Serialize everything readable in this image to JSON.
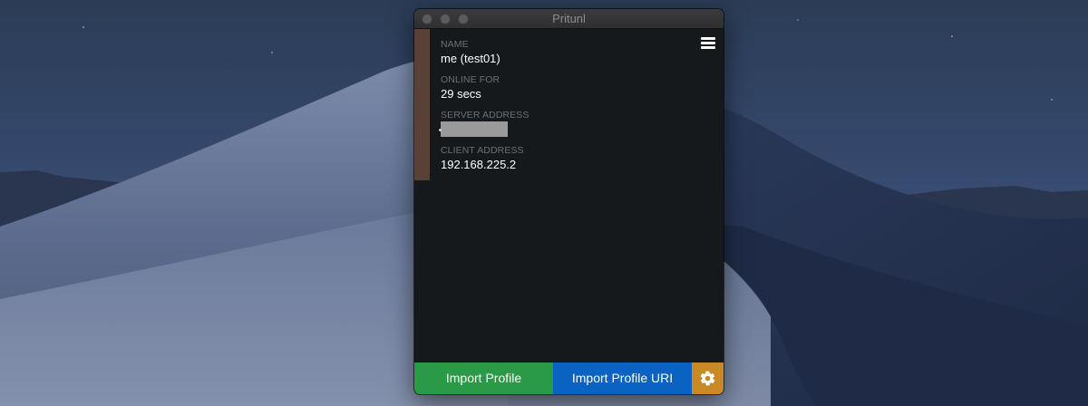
{
  "window": {
    "title": "Pritunl"
  },
  "profile": {
    "status_color": "#5a4137",
    "name_label": "NAME",
    "name_value": "me (test01)",
    "online_label": "ONLINE FOR",
    "online_value": "29 secs",
    "server_label": "SERVER ADDRESS",
    "server_value_redacted": true,
    "client_label": "CLIENT ADDRESS",
    "client_value": "192.168.225.2",
    "menu_icon": "hamburger-menu-icon"
  },
  "footer": {
    "import_profile_label": "Import Profile",
    "import_profile_uri_label": "Import Profile URI",
    "settings_icon": "gear-icon",
    "colors": {
      "import": "#2b9a47",
      "import_uri": "#0a63c2",
      "settings": "#c88a25"
    }
  }
}
